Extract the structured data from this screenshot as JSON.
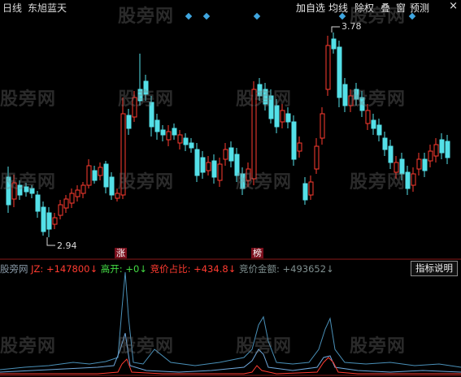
{
  "topbar": {
    "period": "日线",
    "stock_name": "东旭蓝天",
    "buttons": [
      "加自选",
      "均线",
      "除权",
      "叠",
      "窗",
      "预测"
    ],
    "close": "×"
  },
  "chart": {
    "high_label": "3.78",
    "low_label": "2.94",
    "tag_zhang": "涨",
    "tag_bang": "榜"
  },
  "indicator": {
    "prefix": "股旁网",
    "jz": "JZ: +147800↓",
    "gaokai": "高开: +0↓",
    "jingjia_zhanbi": "竞价占比: +434.8↓",
    "jingjia_jine": "竞价金额: +493652↓",
    "help_button": "指标说明"
  },
  "watermark": "股旁网",
  "colors": {
    "up": "#ff3b30",
    "down": "#54e0e8",
    "background": "#000000",
    "indicator_red": "#ff3b30",
    "indicator_green": "#44dd44",
    "indicator_gray": "#7f8f8f"
  }
}
